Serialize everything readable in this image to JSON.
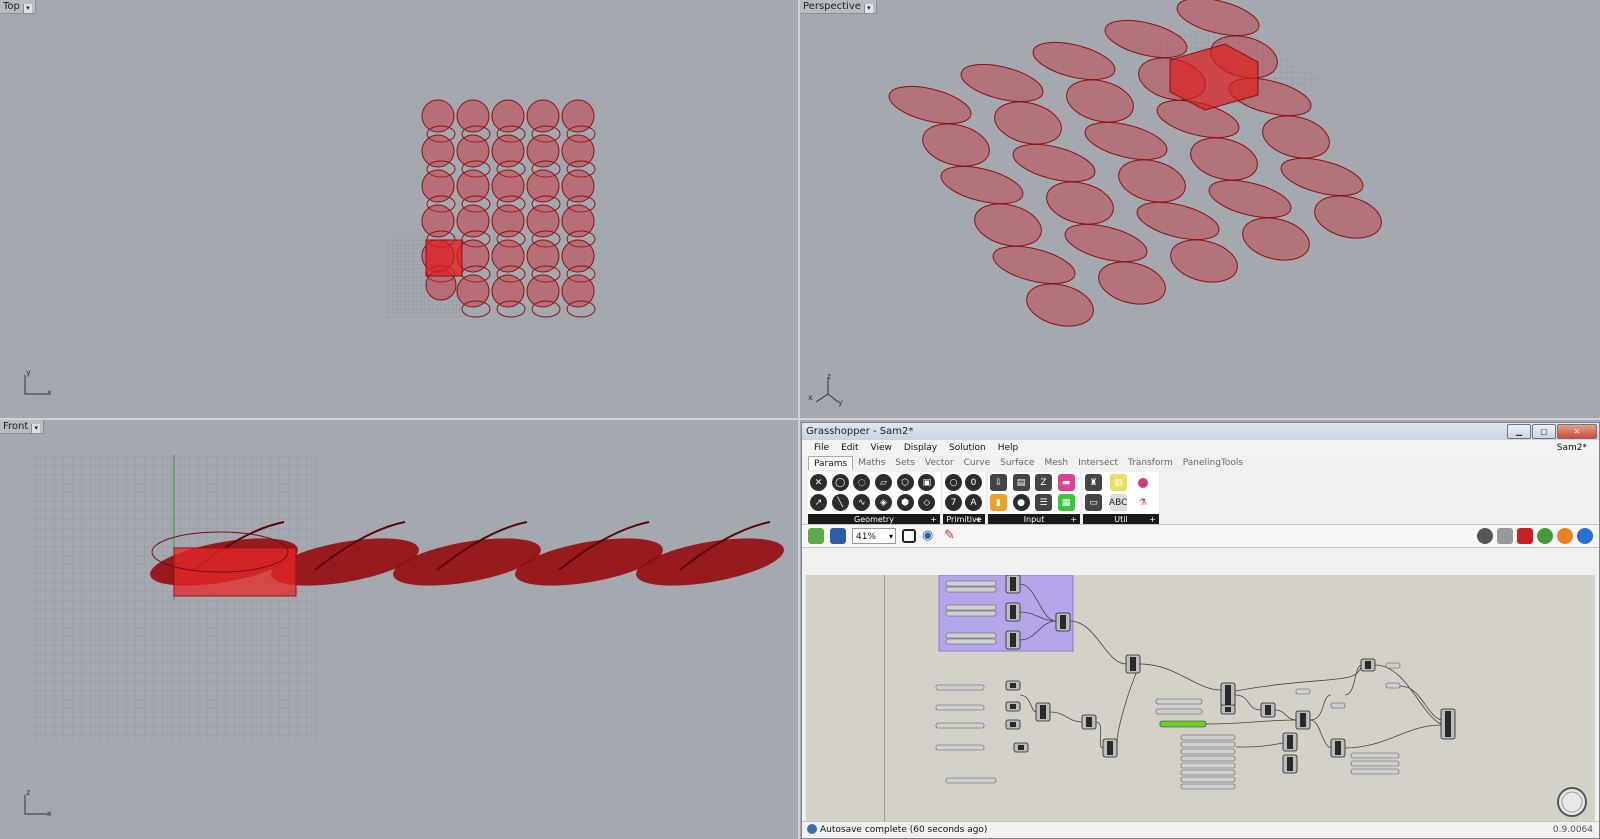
{
  "viewports": {
    "top": {
      "label": "Top",
      "axes": [
        "y",
        "x"
      ]
    },
    "perspective": {
      "label": "Perspective",
      "axes": [
        "z",
        "x",
        "y"
      ]
    },
    "front": {
      "label": "Front",
      "axes": [
        "z",
        "x"
      ]
    }
  },
  "grasshopper": {
    "title": "Grasshopper - Sam2*",
    "document": "Sam2*",
    "menu": [
      "File",
      "Edit",
      "View",
      "Display",
      "Solution",
      "Help"
    ],
    "tabs": [
      "Params",
      "Maths",
      "Sets",
      "Vector",
      "Curve",
      "Surface",
      "Mesh",
      "Intersect",
      "Transform",
      "PanelingTools"
    ],
    "active_tab": "Params",
    "ribbon_groups": [
      {
        "label": "Geometry",
        "plus": "+"
      },
      {
        "label": "Primitive",
        "plus": "+"
      },
      {
        "label": "Input",
        "plus": "+"
      },
      {
        "label": "Util",
        "plus": "+"
      }
    ],
    "zoom": "41%",
    "status": "Autosave complete (60 seconds ago)",
    "version": "0.9.0064",
    "colors": {
      "group": "#b7a5ec",
      "slider_green": "#6bd02e",
      "geometry": "#c8202a"
    }
  }
}
